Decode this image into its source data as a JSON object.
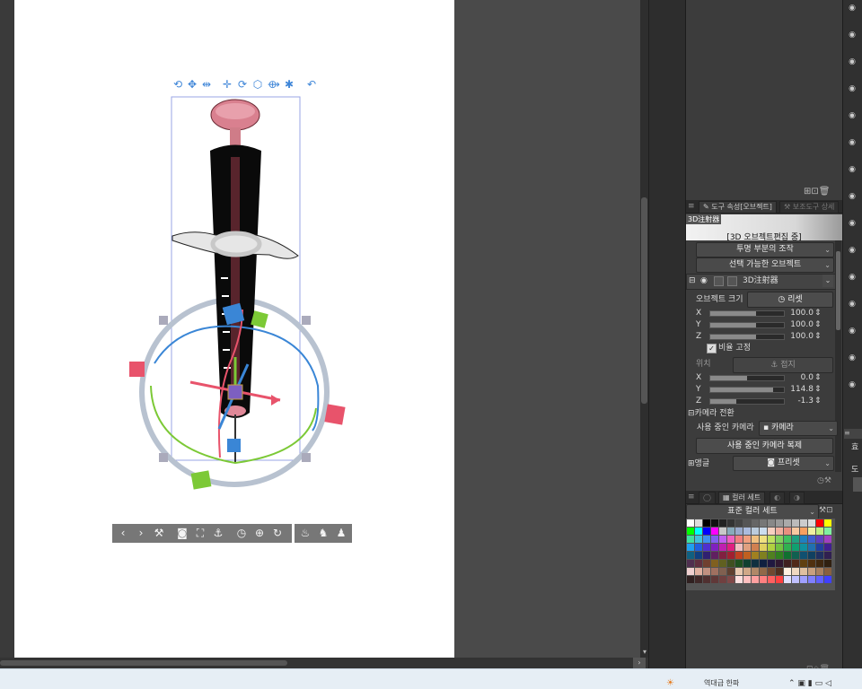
{
  "hud_icons": [
    "rotate-camera-icon",
    "pan-camera-icon",
    "dolly-camera-icon",
    "move-object-icon",
    "rotate-object-icon",
    "cube-icon",
    "scale-object-icon",
    "bug-icon",
    "undo-icon"
  ],
  "hud_glyphs": [
    "⟲",
    "✥",
    "⇹",
    "✛",
    "⟳",
    "⬡",
    "⟴",
    "✱",
    "↶"
  ],
  "toolbar": {
    "icons": [
      "chevron-left-icon",
      "chevron-right-icon",
      "wrench-icon",
      "camera-reset-icon",
      "fit-icon",
      "floor-icon",
      "clock-icon",
      "zoom-icon",
      "refresh-icon"
    ],
    "glyphs": [
      "‹",
      "›",
      "⚒",
      "◙",
      "⛶",
      "⚓",
      "◷",
      "⊕",
      "↻"
    ],
    "right_icons": [
      "light-icon",
      "pose-icon",
      "figure-icon"
    ],
    "right_glyphs": [
      "♨",
      "♞",
      "♟"
    ]
  },
  "tool_property": {
    "tab_active": "도구 속성[오브젝트]",
    "tab_inactive": "보조도구 상세",
    "preview_label": "3D注射器",
    "edit_status": "[3D 오브젝트편집 중]",
    "transparent_op": "투명 부분의 조작",
    "selectable_object": "선택 가능한 오브젝트",
    "object_name": "3D注射器",
    "object_size_label": "오브젝트 크기",
    "reset_label": "리셋",
    "scale": [
      {
        "axis": "X",
        "value": "100.0",
        "fill": 0.62
      },
      {
        "axis": "Y",
        "value": "100.0",
        "fill": 0.62
      },
      {
        "axis": "Z",
        "value": "100.0",
        "fill": 0.62
      }
    ],
    "keep_ratio": "비율 고정",
    "position_label": "위치",
    "ground_label": "접지",
    "position": [
      {
        "axis": "X",
        "value": "0.0",
        "fill": 0.5
      },
      {
        "axis": "Y",
        "value": "114.8",
        "fill": 0.85
      },
      {
        "axis": "Z",
        "value": "-1.3",
        "fill": 0.35
      }
    ],
    "camera_switch": "카메라 전환",
    "camera_in_use_label": "사용 중인 카메라",
    "camera_value": "카메라",
    "duplicate_camera": "사용 중인 카메라 복제",
    "angle_label": "앵글",
    "preset_label": "프리셋"
  },
  "color_set": {
    "tab": "컬러 세트",
    "set_name": "표준 컬러 세트"
  },
  "side_labels": {
    "a": "효",
    "b": "도"
  },
  "taskbar": {
    "text": "역대급 한파"
  },
  "swatches": [
    "#ffffff",
    "#dcdcdc",
    "#000000",
    "#111111",
    "#222222",
    "#333333",
    "#444444",
    "#555555",
    "#666666",
    "#777777",
    "#888888",
    "#999999",
    "#aaaaaa",
    "#bbbbbb",
    "#cccccc",
    "#dddddd",
    "#ff0000",
    "#ffff00",
    "#00ff00",
    "#00ffff",
    "#0000ff",
    "#ff00ff",
    "#c8c8c8",
    "#8ab",
    "#9ac",
    "#abd",
    "#bcd",
    "#cde",
    "#f8d0c0",
    "#f0b0a0",
    "#e89080",
    "#f8c8a0",
    "#f8a060",
    "#f0f0a0",
    "#c0f080",
    "#80f0a0",
    "#40e0a0",
    "#40c0e0",
    "#4090f0",
    "#8060f0",
    "#c060f0",
    "#f060c0",
    "#f08080",
    "#f0a080",
    "#f0c080",
    "#f0e080",
    "#c0e060",
    "#80d060",
    "#40c060",
    "#20a080",
    "#2080c0",
    "#4060d0",
    "#6040c0",
    "#a040c0",
    "#20a0f0",
    "#2060e0",
    "#5030d0",
    "#8020c0",
    "#c020b0",
    "#e02080",
    "#f0c0c0",
    "#e0a080",
    "#d08050",
    "#e0d060",
    "#b0d040",
    "#70c040",
    "#30b050",
    "#10a070",
    "#1090a0",
    "#2070b0",
    "#2040a0",
    "#402090",
    "#106080",
    "#104080",
    "#302070",
    "#602060",
    "#802040",
    "#a02030",
    "#c04020",
    "#c06020",
    "#a08020",
    "#808020",
    "#508020",
    "#308020",
    "#107030",
    "#106050",
    "#105070",
    "#104060",
    "#203060",
    "#302050",
    "#503050",
    "#603040",
    "#704030",
    "#806020",
    "#606020",
    "#405020",
    "#205020",
    "#104030",
    "#103040",
    "#102040",
    "#201840",
    "#301830",
    "#402020",
    "#502818",
    "#604010",
    "#503010",
    "#402810",
    "#302010",
    "#f0d0d0",
    "#e0b0a0",
    "#c09080",
    "#a07060",
    "#806050",
    "#604030",
    "#e8c8b0",
    "#d0a888",
    "#b08868",
    "#906848",
    "#704830",
    "#503020",
    "#fff0e0",
    "#f0d8c0",
    "#e0c0a0",
    "#c8a080",
    "#a88060",
    "#886040",
    "#302020",
    "#402828",
    "#503030",
    "#603838",
    "#704040",
    "#804848",
    "#ffe0e0",
    "#ffc0c0",
    "#ffa0a0",
    "#ff8080",
    "#ff6060",
    "#ff4040",
    "#e0e0ff",
    "#c0c0ff",
    "#a0a0ff",
    "#8080ff",
    "#6060ff",
    "#4040ff"
  ]
}
